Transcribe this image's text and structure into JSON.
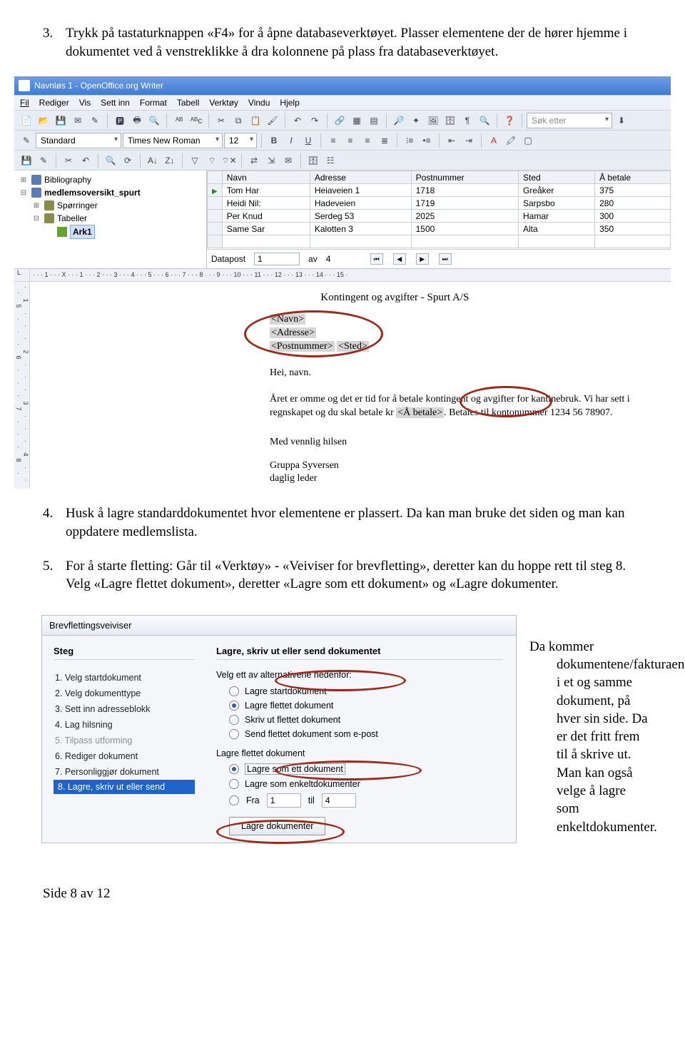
{
  "item3": {
    "num": "3.",
    "text": "Trykk på tastaturknappen «F4» for å åpne databaseverktøyet. Plasser elementene der de hører hjemme i dokumentet ved å venstreklikke å dra kolonnene på plass fra databaseverktøyet."
  },
  "item4": {
    "num": "4.",
    "text": "Husk å lagre standarddokumentet hvor elementene er plassert. Da kan man bruke det siden og man kan oppdatere medlemslista."
  },
  "item5": {
    "num": "5.",
    "text": "For å starte fletting: Går til «Verktøy» - «Veiviser for brevfletting», deretter kan du hoppe rett til steg 8. Velg «Lagre flettet dokument», deretter «Lagre som ett dokument» og «Lagre dokumenter."
  },
  "screenshot1": {
    "title": "Navnløs 1 - OpenOffice.org Writer",
    "menu": [
      "Fil",
      "Rediger",
      "Vis",
      "Sett inn",
      "Format",
      "Tabell",
      "Verktøy",
      "Vindu",
      "Hjelp"
    ],
    "search_placeholder": "Søk etter",
    "style_combo": "Standard",
    "font_combo": "Times New Roman",
    "size_combo": "12",
    "tree": {
      "bibliography": "Bibliography",
      "ds": "medlemsoversikt_spurt",
      "queries": "Spørringer",
      "tables": "Tabeller",
      "sheet": "Ark1"
    },
    "grid": {
      "cols": [
        "Navn",
        "Adresse",
        "Postnummer",
        "Sted",
        "Å betale"
      ],
      "rows": [
        [
          "Tom Har",
          "Heiaveien 1",
          "1718",
          "Greåker",
          "375"
        ],
        [
          "Heidi Nil:",
          "Hadeveien",
          "1719",
          "Sarpsbo",
          "280"
        ],
        [
          "Per Knud",
          "Serdeg 53",
          "2025",
          "Hamar",
          "300"
        ],
        [
          "Same Sar",
          "Kalotten 3",
          "1500",
          "Alta",
          "350"
        ]
      ]
    },
    "nav": {
      "label": "Datapost",
      "value": "1",
      "av": "av",
      "total": "4"
    },
    "ruler_h": "· · · 1 · · · X · · · 1 · · · 2 · · · 3 · · · 4 · · · 5 · · · 6 · · · 7 · · · 8 · · · 9 · · · 10 · · · 11 · · · 12 · · · 13 · · · 14 · · · 15 ·",
    "ruler_v": "· 1 · · · 2 · · · 3 · · · 4 · · · 5 · · · 6 · · · 7 · · · 8 ·",
    "doc": {
      "title": "Kontingent og avgifter - Spurt A/S",
      "ph_navn": "<Navn>",
      "ph_adresse": "<Adresse>",
      "ph_postnr": "<Postnummer>",
      "ph_sted": "<Sted>",
      "hei": "Hei, navn.",
      "body1a": "Året er omme og det er tid for å betale kontingent og avgifter for kantinebruk. Vi har sett i regnskapet og du skal betale kr ",
      "ph_betale": "<Å betale>",
      "body1b": ". Betales til kontonummer 1234 56 78907.",
      "sign1": "Med vennlig hilsen",
      "sign2": "Gruppa Syversen",
      "sign3": "daglig leder"
    }
  },
  "wizard": {
    "title": "Brevflettingsveiviser",
    "steps_label": "Steg",
    "steps": [
      "1. Velg startdokument",
      "2. Velg dokumenttype",
      "3. Sett inn adresseblokk",
      "4. Lag hilsning",
      "5. Tilpass utforming",
      "6. Rediger dokument",
      "7. Personliggjør dokument",
      "8. Lagre, skriv ut eller send"
    ],
    "main_heading": "Lagre, skriv ut eller send dokumentet",
    "choose_label": "Velg ett av alternativene nedenfor:",
    "opt1": "Lagre startdokument",
    "opt2": "Lagre flettet dokument",
    "opt3": "Skriv ut flettet dokument",
    "opt4": "Send flettet dokument som e-post",
    "sub_heading": "Lagre flettet dokument",
    "opt5": "Lagre som ett dokument",
    "opt6": "Lagre som enkeltdokumenter",
    "fra": "Fra",
    "fra_val": "1",
    "til": "til",
    "til_val": "4",
    "save_btn": "Lagre dokumenter"
  },
  "sidenote": {
    "line1": "Da kommer",
    "rest": "dokumentene/fakturaene i et og samme dokument, på hver sin side. Da er det fritt frem til å skrive ut. Man kan også velge å lagre som enkeltdokumenter."
  },
  "footer": "Side 8 av 12"
}
